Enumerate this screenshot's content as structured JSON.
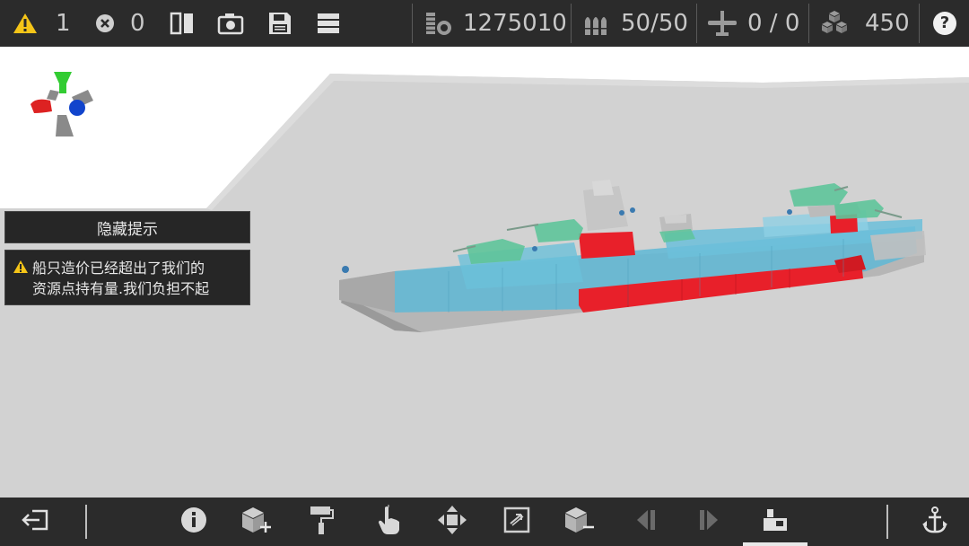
{
  "topbar": {
    "warnings_count": "1",
    "errors_count": "0",
    "resources_value": "1275010",
    "ammo_value": "50/50",
    "aircraft_value": "0 / 0",
    "parts_value": "450",
    "help_label": "?"
  },
  "hints": {
    "hide_button_label": "隐藏提示",
    "warning_line1": "船只造价已经超出了我们的",
    "warning_line2": "资源点持有量.我们负担不起"
  },
  "colors": {
    "bar_bg": "#2b2b2b",
    "warning_yellow": "#f5c518",
    "hull_blue": "#5fb8d6",
    "armor_red": "#e8202a",
    "turret_green": "#5ec49a",
    "axis_green": "#33cc33",
    "axis_red": "#dd2222",
    "axis_blue": "#1144cc"
  },
  "icons": {
    "warning": "warning-triangle-icon",
    "error": "error-x-icon",
    "mirror": "mirror-icon",
    "camera": "camera-icon",
    "save": "save-icon",
    "menu": "menu-icon",
    "resources": "coins-icon",
    "ammo": "shells-icon",
    "aircraft": "plane-icon",
    "parts": "cubes-icon",
    "help": "help-icon",
    "exit": "exit-icon",
    "info": "info-icon",
    "add_block": "add-block-icon",
    "paint": "paint-roller-icon",
    "select": "hand-pointer-icon",
    "move": "move-arrows-icon",
    "rotate": "rotate-frame-icon",
    "remove_block": "remove-block-icon",
    "prev": "prev-icon",
    "next": "next-icon",
    "crane": "crane-icon",
    "anchor": "anchor-icon"
  }
}
